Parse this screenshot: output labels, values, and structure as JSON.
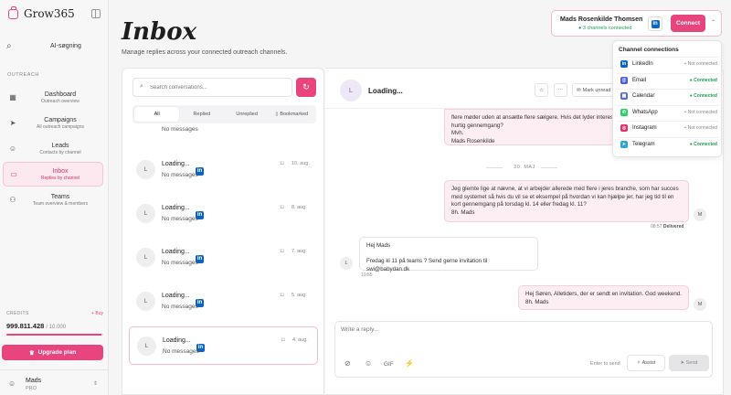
{
  "brand": {
    "name": "Grow365"
  },
  "sidebar": {
    "search_label": "AI-søgning",
    "section_label": "OUTREACH",
    "items": [
      {
        "title": "Dashboard",
        "subtitle": "Outreach overview"
      },
      {
        "title": "Campaigns",
        "subtitle": "All outreach campaigns"
      },
      {
        "title": "Leads",
        "subtitle": "Contacts by channel"
      },
      {
        "title": "Inbox",
        "subtitle": "Replies by channel"
      },
      {
        "title": "Teams",
        "subtitle": "Team overview & members"
      }
    ],
    "credits": {
      "label": "CREDITS",
      "buy": "+ Buy",
      "value": "999.811.428",
      "total": "/ 10.000",
      "fill_fraction": 0.98
    },
    "upgrade_label": "Upgrade plan",
    "user": {
      "name": "Mads",
      "plan": "PRO"
    }
  },
  "page": {
    "title": "Inbox",
    "subtitle": "Manage replies across your connected outreach channels."
  },
  "account": {
    "name": "Mads Rosenkilde Thomsen",
    "status": "3 channels connected",
    "connect_label": "Connect"
  },
  "channels": {
    "title": "Channel connections",
    "items": [
      {
        "name": "LinkedIn",
        "status": "Not connected",
        "connected": false,
        "color": "#0a66c2",
        "icon": "in"
      },
      {
        "name": "Email",
        "status": "Connected",
        "connected": true,
        "color": "#4b5bd6",
        "icon": "@"
      },
      {
        "name": "Calendar",
        "status": "Connected",
        "connected": true,
        "color": "#5a6be0",
        "icon": "▦"
      },
      {
        "name": "WhatsApp",
        "status": "Not connected",
        "connected": false,
        "color": "#25d366",
        "icon": "✆"
      },
      {
        "name": "Instagram",
        "status": "Not connected",
        "connected": false,
        "color": "#e1306c",
        "icon": "◎"
      },
      {
        "name": "Telegram",
        "status": "Connected",
        "connected": true,
        "color": "#2aa3de",
        "icon": "➤"
      }
    ]
  },
  "list": {
    "search_placeholder": "Search conversations...",
    "tabs": [
      "All",
      "Replied",
      "Unreplied",
      "Bookmarked"
    ],
    "partial_message": "No messages",
    "conversations": [
      {
        "initial": "L",
        "name": "Loading...",
        "message": "No messages",
        "date": "10. aug."
      },
      {
        "initial": "L",
        "name": "Loading...",
        "message": "No messages",
        "date": "8. aug."
      },
      {
        "initial": "L",
        "name": "Loading...",
        "message": "No messages",
        "date": "7. aug."
      },
      {
        "initial": "L",
        "name": "Loading...",
        "message": "No messages",
        "date": "5. aug."
      },
      {
        "initial": "L",
        "name": "Loading...",
        "message": "No messages",
        "date": "4. aug."
      }
    ]
  },
  "chat": {
    "contact_initial": "L",
    "contact_name": "Loading...",
    "mark_unread_label": "Mark unread",
    "messages": [
      {
        "text": "flere møder uden at ansætte flere sælgere. Hvis det lyder interessant, kan vi tage en hurtig gennemgang?\nMvh.\nMads Rosenkilde"
      },
      {
        "date_separator": "30. MAJ"
      },
      {
        "text": "Jeg glemte lige at nævne, at vi arbejder allerede med flere i jeres branche, som har succes med systemet så hvis du vil se et eksempel på hvordan vi kan hjælpe jer, har jeg tid til en kort gennemgang på torsdag kl. 14 eller fredag kl. 11?\n8h. Mads",
        "time": "08:57",
        "status": "Delivered",
        "initial": "M"
      },
      {
        "text": "Hej Mads\n\nFredag kl 11 på teams ? Send gerne invitation til swi@babydan.dk",
        "time": "10:55",
        "initial": "L"
      },
      {
        "text": "Hej Søren, Alletiders, der er sendt en invitation. God weekend.\n8h. Mads",
        "initial": "M"
      }
    ]
  },
  "composer": {
    "placeholder": "Write a reply...",
    "gif_label": "GIF",
    "hint": "Enter to send",
    "assist_label": "Assist",
    "send_label": "Send"
  }
}
